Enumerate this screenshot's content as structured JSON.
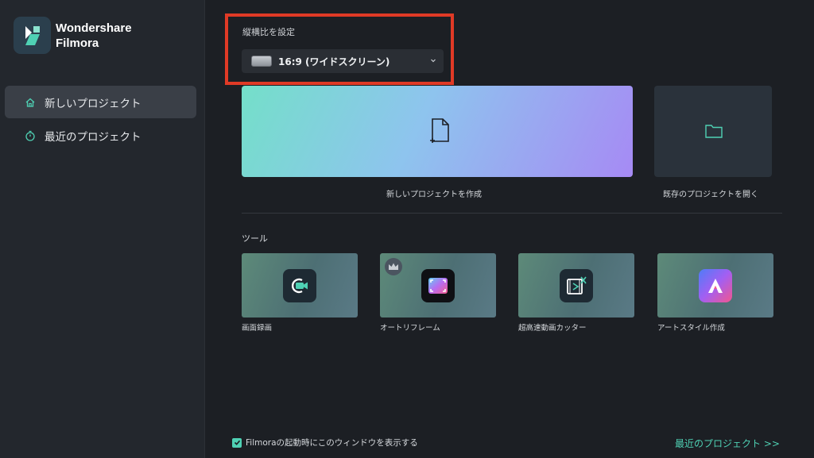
{
  "app": {
    "name": "Wondershare\nFilmora",
    "brand_color": "#4fd1b4",
    "logo_icon": "filmora-logo-icon"
  },
  "sidebar": {
    "items": [
      {
        "label": "新しいプロジェクト",
        "icon": "home-icon",
        "active": true
      },
      {
        "label": "最近のプロジェクト",
        "icon": "timer-icon",
        "active": false
      }
    ]
  },
  "aspect": {
    "label": "縦横比を設定",
    "selected": "16:9 (ワイドスクリーン)",
    "highlight_color": "#e03a26"
  },
  "cards": {
    "new_project": {
      "caption": "新しいプロジェクトを作成",
      "icon": "new-file-icon"
    },
    "open_project": {
      "caption": "既存のプロジェクトを開く",
      "icon": "folder-icon"
    }
  },
  "tools": {
    "label": "ツール",
    "items": [
      {
        "caption": "画面録画",
        "icon": "screen-record-icon"
      },
      {
        "caption": "オートリフレーム",
        "icon": "auto-reframe-icon",
        "badge": "crown-icon"
      },
      {
        "caption": "超高速動画カッター",
        "icon": "video-cutter-icon"
      },
      {
        "caption": "アートスタイル作成",
        "icon": "art-style-icon"
      }
    ]
  },
  "footer": {
    "checkbox_label": "Filmoraの起動時にこのウィンドウを表示する",
    "checked": true,
    "recent_link": "最近のプロジェクト >>"
  }
}
